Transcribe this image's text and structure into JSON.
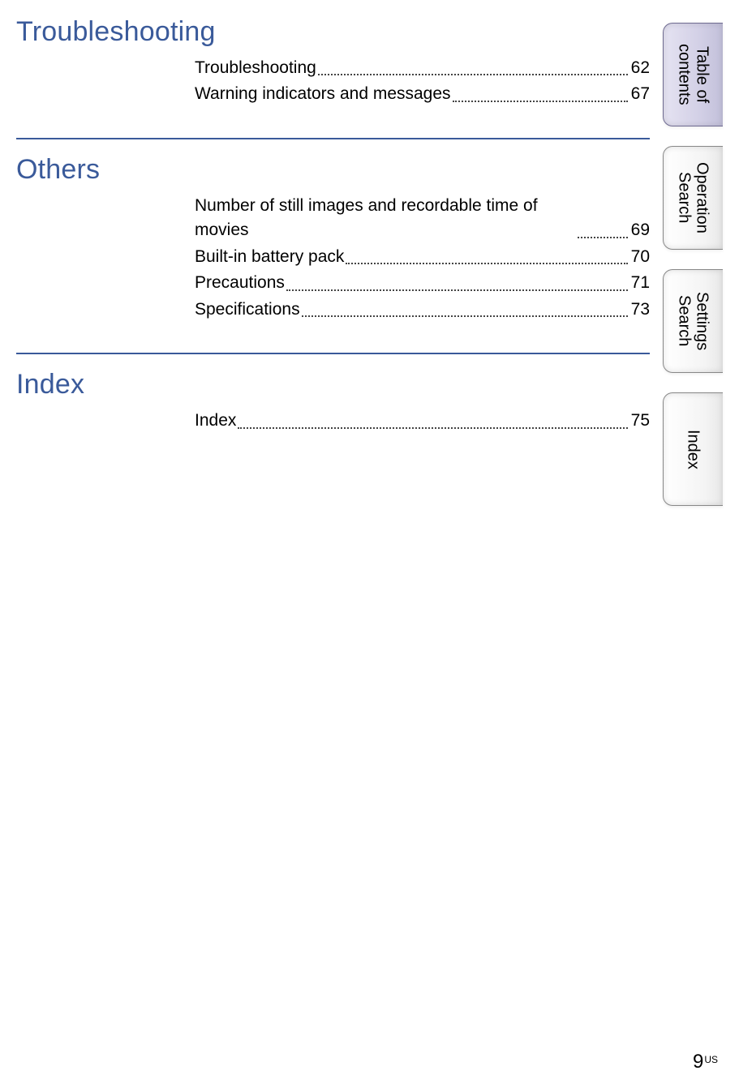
{
  "sections": [
    {
      "heading": "Troubleshooting",
      "items": [
        {
          "label": "Troubleshooting",
          "page": "62"
        },
        {
          "label": "Warning indicators and messages",
          "page": "67"
        }
      ]
    },
    {
      "heading": "Others",
      "items": [
        {
          "label": "Number of still images and recordable time of movies",
          "page": "69"
        },
        {
          "label": "Built-in battery pack",
          "page": "70"
        },
        {
          "label": "Precautions",
          "page": "71"
        },
        {
          "label": "Specifications",
          "page": "73"
        }
      ]
    },
    {
      "heading": "Index",
      "items": [
        {
          "label": "Index",
          "page": "75"
        }
      ]
    }
  ],
  "tabs": [
    {
      "label": "Table of\ncontents",
      "active": true
    },
    {
      "label": "Operation\nSearch",
      "active": false
    },
    {
      "label": "Settings\nSearch",
      "active": false
    },
    {
      "label": "Index",
      "active": false
    }
  ],
  "footer": {
    "page_number": "9",
    "region": "US"
  }
}
